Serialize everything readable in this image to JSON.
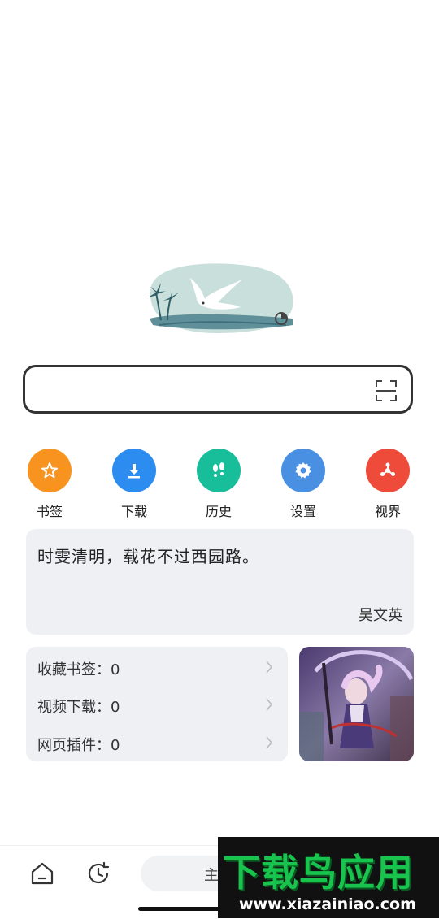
{
  "search": {
    "placeholder": ""
  },
  "quick_links": [
    {
      "label": "书签",
      "icon": "star-icon",
      "color": "#f7931e"
    },
    {
      "label": "下载",
      "icon": "download-icon",
      "color": "#2d8cf0"
    },
    {
      "label": "历史",
      "icon": "footprints-icon",
      "color": "#18be9a"
    },
    {
      "label": "设置",
      "icon": "gear-icon",
      "color": "#4a90e2"
    },
    {
      "label": "视界",
      "icon": "discover-icon",
      "color": "#ee4b3b"
    }
  ],
  "poem": {
    "text": "时雯清明，载花不过西园路。",
    "author": "吴文英"
  },
  "stats": [
    {
      "label": "收藏书签：0"
    },
    {
      "label": "视频下载：0"
    },
    {
      "label": "网页插件：0"
    }
  ],
  "bottom_bar": {
    "main_label": "主"
  },
  "watermark": {
    "title": "下载鸟应用",
    "url": "www.xiazainiao.com"
  }
}
